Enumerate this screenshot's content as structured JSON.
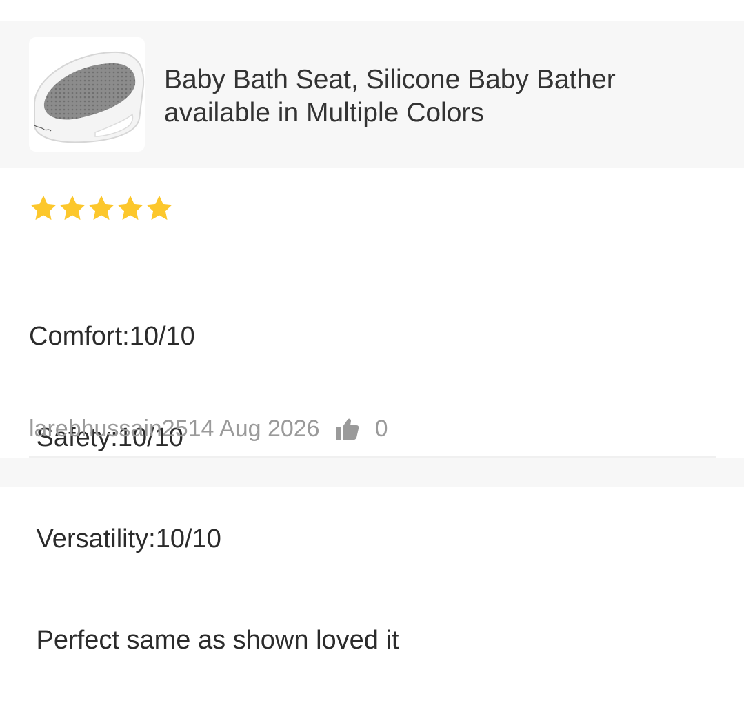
{
  "product": {
    "image_icon": "baby-bath-seat-image",
    "title_line1": "Baby Bath Seat, Silicone Baby Bather",
    "title_line2": "available in Multiple Colors"
  },
  "review": {
    "rating": 5,
    "rating_max": 5,
    "star_color": "#fcc72c",
    "lines": [
      "Comfort:10/10",
      " Safety:10/10",
      " Versatility:10/10",
      " Perfect same as shown loved it"
    ],
    "author": "larebhussain25",
    "date": "14 Aug 2026",
    "like_icon": "thumbs-up-icon",
    "like_count": "0"
  },
  "colors": {
    "header_bg": "#f7f7f7",
    "text": "#333333",
    "meta_text": "#9a9a9a"
  }
}
